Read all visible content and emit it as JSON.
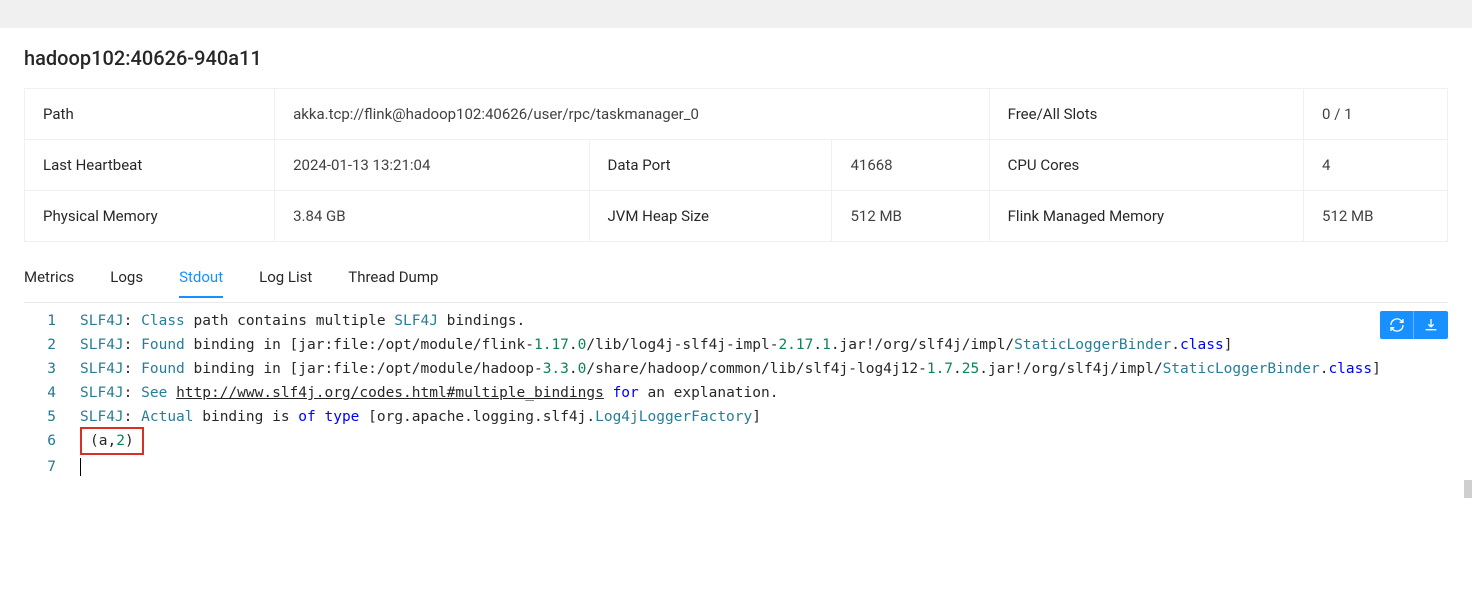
{
  "title": "hadoop102:40626-940a11",
  "info": {
    "path_label": "Path",
    "path_value": "akka.tcp://flink@hadoop102:40626/user/rpc/taskmanager_0",
    "slots_label": "Free/All Slots",
    "slots_value": "0 / 1",
    "heartbeat_label": "Last Heartbeat",
    "heartbeat_value": "2024-01-13 13:21:04",
    "dataport_label": "Data Port",
    "dataport_value": "41668",
    "cpu_label": "CPU Cores",
    "cpu_value": "4",
    "physmem_label": "Physical Memory",
    "physmem_value": "3.84 GB",
    "heap_label": "JVM Heap Size",
    "heap_value": "512 MB",
    "managed_label": "Flink Managed Memory",
    "managed_value": "512 MB"
  },
  "tabs": {
    "metrics": "Metrics",
    "logs": "Logs",
    "stdout": "Stdout",
    "loglist": "Log List",
    "threaddump": "Thread Dump"
  },
  "stdout": {
    "ln1": "1",
    "ln2": "2",
    "ln3": "3",
    "ln4": "4",
    "ln5": "5",
    "ln6": "6",
    "ln7": "7",
    "l1_a": "SLF4J",
    "l1_b": ": ",
    "l1_c": "Class",
    "l1_d": " path contains multiple ",
    "l1_e": "SLF4J",
    "l1_f": " bindings.",
    "l2_a": "SLF4J",
    "l2_b": ": ",
    "l2_c": "Found",
    "l2_d": " binding in [jar:file:/opt/module/flink-",
    "l2_e": "1.17",
    "l2_f": ".",
    "l2_g": "0",
    "l2_h": "/lib/log4j-slf4j-impl-",
    "l2_i": "2.17",
    "l2_j": ".",
    "l2_k": "1",
    "l2_l": ".jar!/org/slf4j/impl/",
    "l2_m": "StaticLoggerBinder",
    "l2_n": ".",
    "l2_o": "class",
    "l2_p": "]",
    "l3_a": "SLF4J",
    "l3_b": ": ",
    "l3_c": "Found",
    "l3_d": " binding in [jar:file:/opt/module/hadoop-",
    "l3_e": "3.3",
    "l3_f": ".",
    "l3_g": "0",
    "l3_h": "/share/hadoop/common/lib/slf4j-log4j12-",
    "l3_i": "1.7",
    "l3_j": ".",
    "l3_k": "25",
    "l3_l": ".jar!/org/slf4j/impl/",
    "l3_m": "StaticLoggerBinder",
    "l3_n": ".",
    "l3_o": "class",
    "l3_p": "]",
    "l4_a": "SLF4J",
    "l4_b": ": ",
    "l4_c": "See",
    "l4_d": " ",
    "l4_e": "http://www.slf4j.org/codes.html#multiple_bindings",
    "l4_f": " ",
    "l4_g": "for",
    "l4_h": " an explanation.",
    "l5_a": "SLF4J",
    "l5_b": ": ",
    "l5_c": "Actual",
    "l5_d": " binding is ",
    "l5_e": "of",
    "l5_f": " ",
    "l5_g": "type",
    "l5_h": " [org.apache.logging.slf4j.",
    "l5_i": "Log4jLoggerFactory",
    "l5_j": "]",
    "l6_a": "(a,",
    "l6_b": "2",
    "l6_c": ")"
  }
}
